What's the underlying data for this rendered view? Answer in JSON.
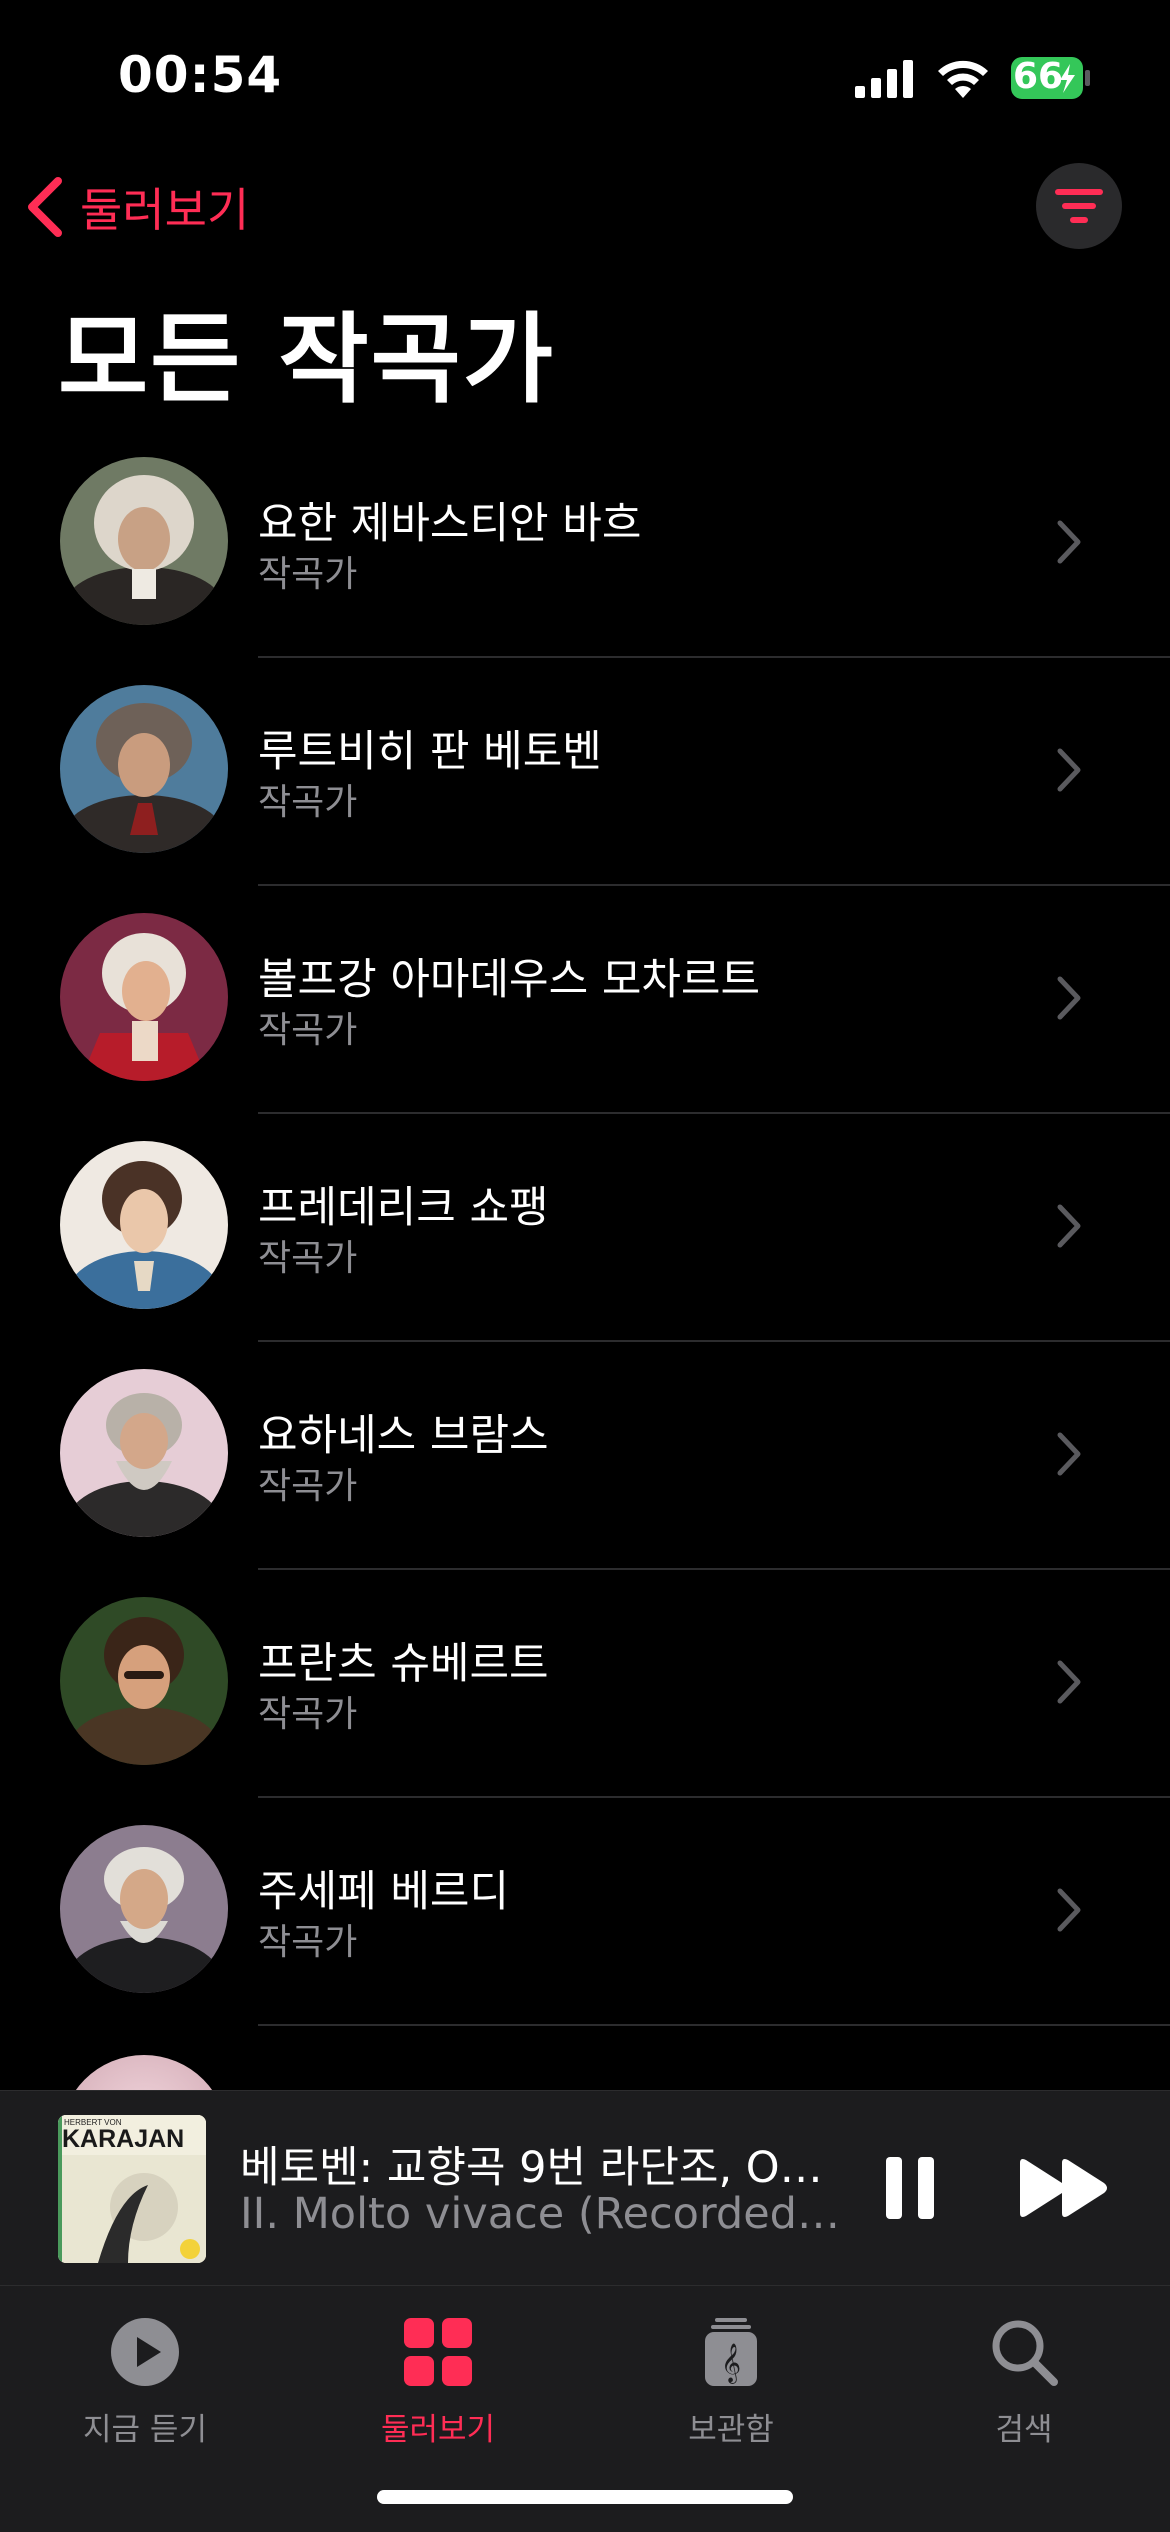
{
  "status_bar": {
    "time": "00:54",
    "battery": "66"
  },
  "nav": {
    "back_label": "둘러보기"
  },
  "page_title": "모든 작곡가",
  "composers": [
    {
      "name": "요한 제바스티안 바흐",
      "subtitle": "작곡가"
    },
    {
      "name": "루트비히 판 베토벤",
      "subtitle": "작곡가"
    },
    {
      "name": "볼프강 아마데우스 모차르트",
      "subtitle": "작곡가"
    },
    {
      "name": "프레데리크 쇼팽",
      "subtitle": "작곡가"
    },
    {
      "name": "요하네스 브람스",
      "subtitle": "작곡가"
    },
    {
      "name": "프란츠 슈베르트",
      "subtitle": "작곡가"
    },
    {
      "name": "주세페 베르디",
      "subtitle": "작곡가"
    }
  ],
  "now_playing": {
    "title": "베토벤: 교향곡 9번 라단조, Op....",
    "subtitle": "II. Molto vivace (Recorded 1...",
    "album_art_text": "KARAJAN",
    "album_art_top_text": "HERBERT VON"
  },
  "tabs": [
    {
      "label": "지금 듣기",
      "icon": "play-circle-icon",
      "active": false
    },
    {
      "label": "둘러보기",
      "icon": "grid-icon",
      "active": true
    },
    {
      "label": "보관함",
      "icon": "library-icon",
      "active": false
    },
    {
      "label": "검색",
      "icon": "search-icon",
      "active": false
    }
  ],
  "colors": {
    "accent": "#ff2d55",
    "background": "#000000",
    "secondary_text": "#8e8e93",
    "battery_green": "#34c759"
  }
}
